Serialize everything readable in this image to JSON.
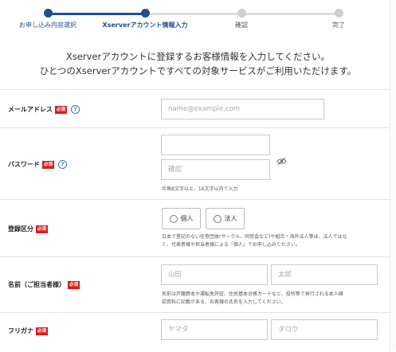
{
  "progress": {
    "steps": [
      {
        "label": "お申し込み内容選択",
        "state": "done"
      },
      {
        "label": "Xserverアカウント情報入力",
        "state": "current"
      },
      {
        "label": "確認",
        "state": "todo"
      },
      {
        "label": "完了",
        "state": "todo"
      }
    ]
  },
  "intro": {
    "line1": "Xserverアカウントに登録するお客様情報を入力してください。",
    "line2": "ひとつのXserverアカウントですべての対象サービスがご利用いただけます。"
  },
  "required_badge": "必須",
  "help_icon_glyph": "?",
  "form": {
    "email": {
      "label": "メールアドレス",
      "placeholder": "name@example.com"
    },
    "password": {
      "label": "パスワード",
      "placeholder": "",
      "confirm_placeholder": "確認",
      "note": "半角8文字以上、16文字以内で入力"
    },
    "registration_type": {
      "label": "登録区分",
      "options": [
        "個人",
        "法人"
      ],
      "note_line1": "日本で登記のない任意団体(サークル、同窓会など)や組合・海外法人等は、法人ではな",
      "note_line2": "く、代表者様や担当者様による「個人」でお申し込みください。"
    },
    "name": {
      "label": "名前（ご担当者様）",
      "last_placeholder": "山田",
      "first_placeholder": "太郎",
      "note_line1": "名前は戸籍謄本や運転免許証、住民基本台帳カードなど、役所等で発行される本人確",
      "note_line2": "認資料に記載がある、お客様の氏名を入力してください。"
    },
    "furigana": {
      "label": "フリガナ",
      "last_placeholder": "ヤマダ",
      "first_placeholder": "タロウ"
    }
  },
  "colors": {
    "accent": "#1f4f8f",
    "required": "#d81c1c",
    "inactive": "#cfcfcf"
  },
  "icons": {
    "password_toggle": "eye-slash-icon",
    "help": "help-circle-icon"
  }
}
